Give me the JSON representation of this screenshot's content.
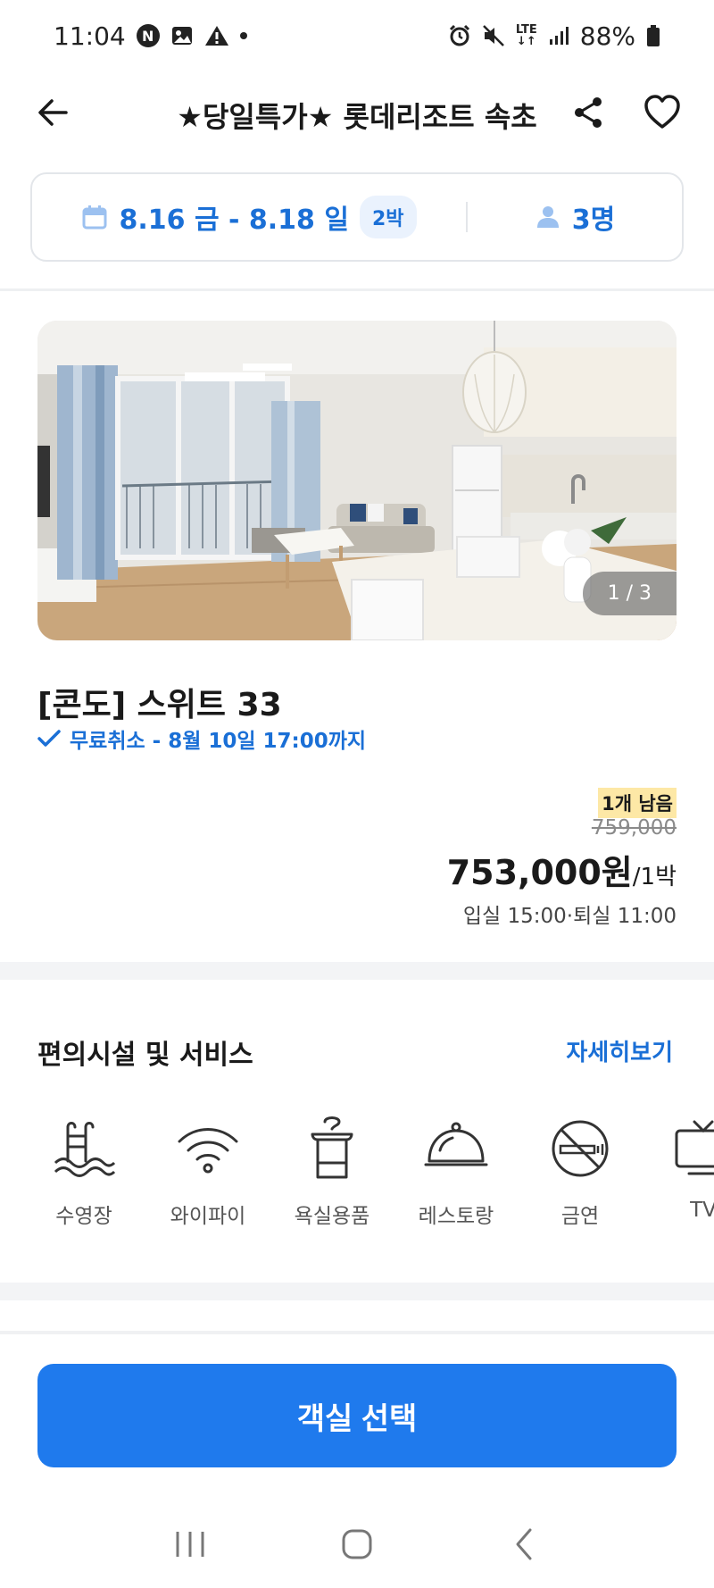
{
  "status_bar": {
    "time": "11:04",
    "n_badge": "N",
    "battery": "88%",
    "network": "LTE"
  },
  "header": {
    "title": "★당일특가★ 롯데리조트 속초",
    "icons": [
      "back-arrow-icon",
      "share-icon",
      "heart-icon"
    ]
  },
  "booking": {
    "dates": "8.16 금 - 8.18 일",
    "nights": "2박",
    "guests": "3명"
  },
  "photo": {
    "counter": "1 / 3"
  },
  "room": {
    "name": "[콘도] 스위트 33",
    "cancel": "무료취소 - 8월 10일 17:00까지",
    "remaining": "1개 남음",
    "original_price": "759,000",
    "price": "753,000원",
    "per_night": "/1박",
    "checkin_out": "입실 15:00·퇴실 11:00"
  },
  "facilities": {
    "title": "편의시설 및 서비스",
    "more": "자세히보기",
    "items": [
      {
        "label": "수영장",
        "icon": "pool-icon"
      },
      {
        "label": "와이파이",
        "icon": "wifi-icon"
      },
      {
        "label": "욕실용품",
        "icon": "toiletries-icon"
      },
      {
        "label": "레스토랑",
        "icon": "restaurant-icon"
      },
      {
        "label": "금연",
        "icon": "no-smoking-icon"
      },
      {
        "label": "TV",
        "icon": "tv-icon"
      }
    ]
  },
  "cta": {
    "label": "객실 선택"
  },
  "colors": {
    "accent": "#1f7aed",
    "link": "#1a6fd6",
    "highlight": "#fde8a6"
  }
}
